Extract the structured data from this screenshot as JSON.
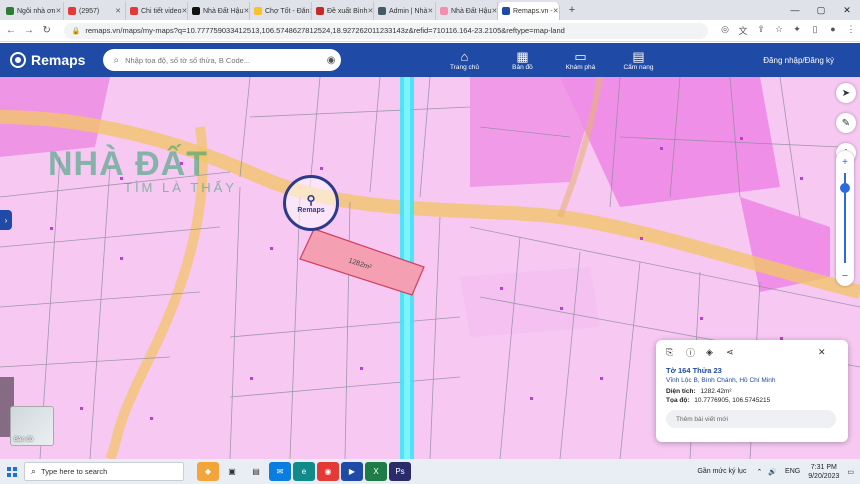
{
  "browser": {
    "tabs": [
      {
        "title": "Ngôi nhà ơn",
        "color": "#2e7d32",
        "active": false
      },
      {
        "title": "(2957)",
        "color": "#e53935",
        "active": false
      },
      {
        "title": "Chi tiết video",
        "color": "#e53935",
        "active": false
      },
      {
        "title": "Nhà Đất Hậu",
        "color": "#111111",
        "active": false
      },
      {
        "title": "Chợ Tốt - Đăn",
        "color": "#fbc02d",
        "active": false
      },
      {
        "title": "Đề xuất Bình",
        "color": "#c62828",
        "active": false
      },
      {
        "title": "Admin | Nhà",
        "color": "#455a64",
        "active": false
      },
      {
        "title": "Nhà Đất Hậu",
        "color": "#f48fb1",
        "active": false
      },
      {
        "title": "Remaps.vn -",
        "color": "#1f4aa5",
        "active": true
      }
    ],
    "new_tab": "+",
    "url": "remaps.vn/maps/my-maps?q=10.7777590334125​13,106.574862781252​4,18.92726201123314​3z&refid=710116.164-23.2105&reftype=map-land"
  },
  "header": {
    "logo": "Remaps",
    "search_placeholder": "Nhập tọa độ, số tờ số thửa, B Code...",
    "nav": [
      {
        "label": "Trang chủ",
        "icon": "home-icon",
        "glyph": "⌂"
      },
      {
        "label": "Bản đồ",
        "icon": "map-icon",
        "glyph": "▦"
      },
      {
        "label": "Khám phá",
        "icon": "explore-icon",
        "glyph": "▭"
      },
      {
        "label": "Cẩm nang",
        "icon": "handbook-icon",
        "glyph": "▤"
      }
    ],
    "login": "Đăng nhập/Đăng ký"
  },
  "map": {
    "watermark_main": "NHÀ ĐẤT",
    "watermark_sub": "TÌM LÀ THẤY",
    "stamp": "Remaps",
    "parcel_label": "1282m²",
    "thumbnail_label": "Bản đồ",
    "zoom_in": "+",
    "zoom_out": "−"
  },
  "info_card": {
    "title": "Tờ 164 Thửa 23",
    "address": "Vĩnh Lộc B, Bình Chánh, Hồ Chí Minh",
    "area_label": "Diện tích:",
    "area_value": "1282.42m²",
    "coord_label": "Tọa độ:",
    "coord_value": "10.7776905, 106.5745215",
    "button": "Thêm bài viết mới"
  },
  "taskbar": {
    "search_placeholder": "Type here to search",
    "tray_app": "Gần mức ký lục",
    "lang": "ENG",
    "time": "7:31 PM",
    "date": "9/20/2023"
  }
}
